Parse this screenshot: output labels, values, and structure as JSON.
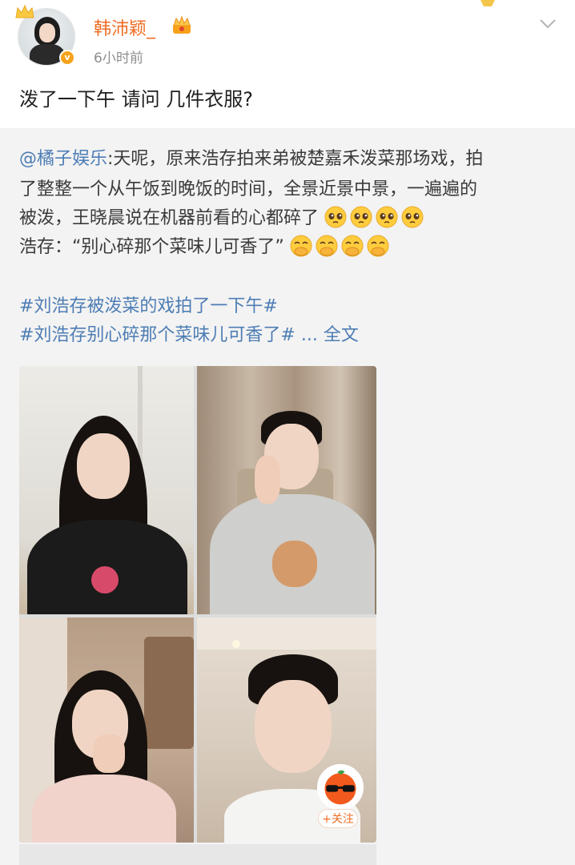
{
  "post": {
    "username": "韩沛颖_",
    "timestamp": "6小时前",
    "text": "泼了一下午 请问 几件衣服?",
    "verified_mark": "v",
    "verified_color": "#f7a21b",
    "username_color": "#ef6c23"
  },
  "repost": {
    "mention": "@橘子娱乐",
    "line1_rest": ":天呢，原来浩存拍来弟被楚嘉禾泼菜那场戏，拍",
    "line2": "了整整一个从午饭到晚饭的时间，全景近景中景，一遍遍的",
    "line3": "被泼，王晓晨说在机器前看的心都碎了",
    "line4": "浩存：“别心碎那个菜味儿可香了”",
    "hashtag1": "#刘浩存被泼菜的戏拍了一下午#",
    "hashtag2": "#刘浩存别心碎那个菜味儿可香了#",
    "more": "... 全文",
    "link_color": "#4d7db4",
    "emoji_line3": "pleading-face-icon",
    "emoji_line4": "face-with-hand-over-mouth-icon"
  },
  "images": {
    "follow_label": "+关注"
  }
}
